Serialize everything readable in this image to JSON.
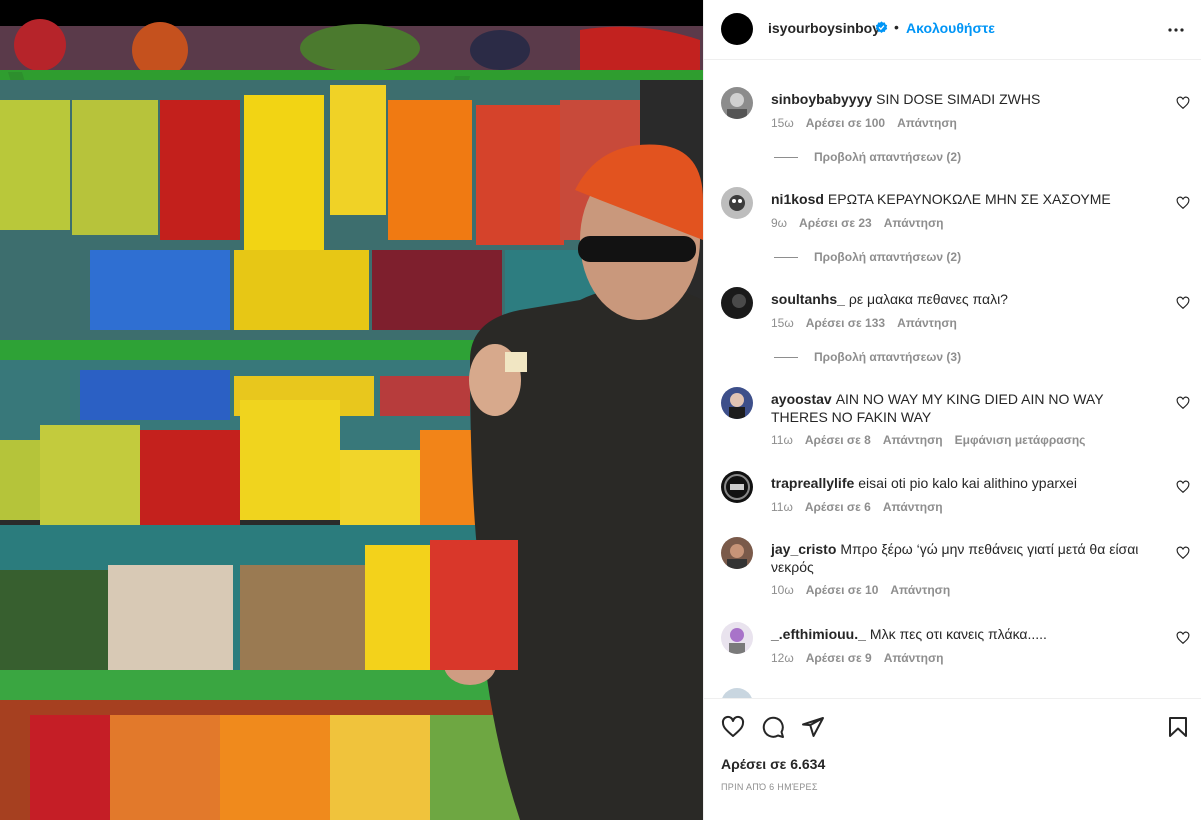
{
  "post": {
    "author": "isyourboysinboy",
    "follow_label": "Ακολουθήστε",
    "dot": "•",
    "likes_label": "Αρέσει σε 6.634",
    "timestamp": "ΠΡΙΝ ΑΠΌ 6 ΗΜΈΡΕΣ"
  },
  "icons": {
    "more": "more-options-icon",
    "verified": "verified-badge-icon",
    "like": "heart-icon",
    "comment": "comment-bubble-icon",
    "share": "send-paper-plane-icon",
    "save": "bookmark-icon"
  },
  "colors": {
    "link_blue": "#0095f6",
    "text": "#262626",
    "muted": "#8e8e8e",
    "border": "#efefef"
  },
  "comments": [
    {
      "user": "sinboybabyyyy",
      "text": "SIN DOSE SIMADI ZWHS",
      "time": "15ω",
      "likes": "Αρέσει σε 100",
      "reply": "Απάντηση",
      "view_replies": "Προβολή απαντήσεων (2)"
    },
    {
      "user": "ni1kosd",
      "text": "ΕΡΩΤΑ ΚΕΡΑΥΝΟΚΩΛΕ ΜΗΝ ΣΕ ΧΑΣΟΥΜΕ",
      "time": "9ω",
      "likes": "Αρέσει σε 23",
      "reply": "Απάντηση",
      "view_replies": "Προβολή απαντήσεων (2)"
    },
    {
      "user": "soultanhs_",
      "text": "ρε μαλακα πεθανες παλι?",
      "time": "15ω",
      "likes": "Αρέσει σε 133",
      "reply": "Απάντηση",
      "view_replies": "Προβολή απαντήσεων (3)"
    },
    {
      "user": "ayoostav",
      "text": "AIN NO WAY MY KING DIED AIN NO WAY THERES NO FAKIN WAY",
      "time": "11ω",
      "likes": "Αρέσει σε 8",
      "reply": "Απάντηση",
      "translate": "Εμφάνιση μετάφρασης"
    },
    {
      "user": "trapreallylife",
      "text": "eisai oti pio kalo kai alithino yparxei",
      "time": "11ω",
      "likes": "Αρέσει σε 6",
      "reply": "Απάντηση"
    },
    {
      "user": "jay_cristo",
      "text": "Μπρο ξέρω ‘γώ μην πεθάνεις γιατί μετά θα είσαι νεκρός",
      "time": "10ω",
      "likes": "Αρέσει σε 10",
      "reply": "Απάντηση"
    },
    {
      "user": "_.efthimiouu._",
      "text": "Μλκ πες οτι κανεις πλάκα.....",
      "time": "12ω",
      "likes": "Αρέσει σε 9",
      "reply": "Απάντηση"
    }
  ]
}
